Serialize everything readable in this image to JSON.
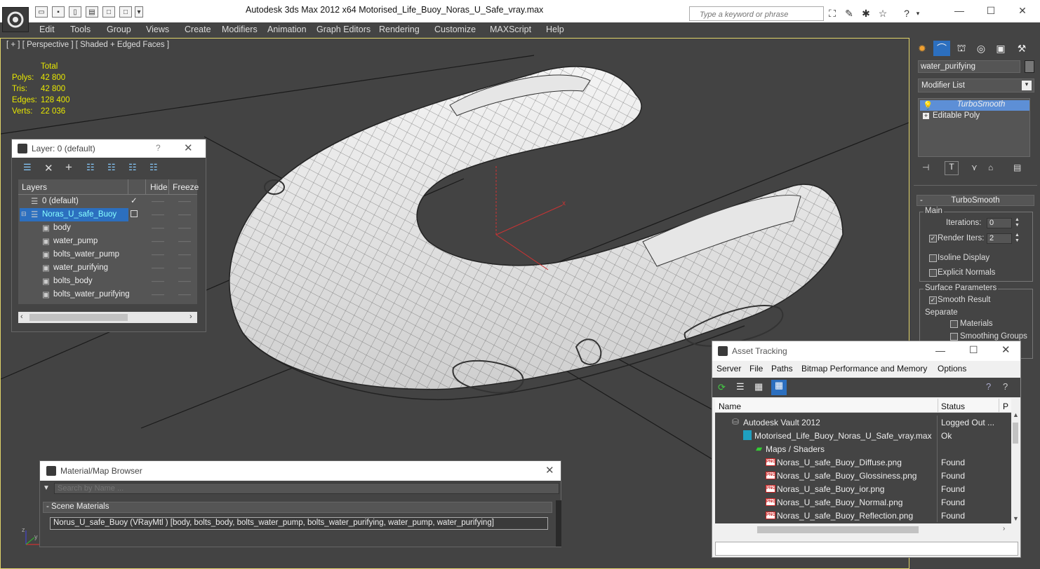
{
  "app": {
    "title": "Autodesk 3ds Max  2012 x64     Motorised_Life_Buoy_Noras_U_Safe_vray.max",
    "search_placeholder": "Type a keyword or phrase"
  },
  "menu": [
    "Edit",
    "Tools",
    "Group",
    "Views",
    "Create",
    "Modifiers",
    "Animation",
    "Graph Editors",
    "Rendering",
    "Customize",
    "MAXScript",
    "Help"
  ],
  "viewport": {
    "label": "[ + ] [ Perspective ] [ Shaded + Edged Faces ]",
    "stats": {
      "header": "Total",
      "rows": [
        {
          "label": "Polys:",
          "value": "42 800"
        },
        {
          "label": "Tris:",
          "value": "42 800"
        },
        {
          "label": "Edges:",
          "value": "128 400"
        },
        {
          "label": "Verts:",
          "value": "22 036"
        }
      ]
    },
    "axis_x": "x",
    "axis_y": "y",
    "axis_z": "z"
  },
  "command_panel": {
    "object_name": "water_purifying",
    "modifier_list": "Modifier List",
    "stack": [
      "TurboSmooth",
      "Editable Poly"
    ],
    "rollout_title": "TurboSmooth",
    "main_group": "Main",
    "iterations_label": "Iterations:",
    "iterations_value": "0",
    "render_iters_label": "Render Iters:",
    "render_iters_value": "2",
    "isoline_label": "Isoline Display",
    "explicit_normals_label": "Explicit Normals",
    "surface_group": "Surface Parameters",
    "smooth_result_label": "Smooth Result",
    "separate_label": "Separate",
    "materials_label": "Materials",
    "smoothing_groups_label": "Smoothing Groups"
  },
  "layer_window": {
    "title": "Layer: 0 (default)",
    "help": "?",
    "columns": [
      "Layers",
      "Hide",
      "Freeze"
    ],
    "rows": [
      {
        "name": "0 (default)",
        "indent": 1,
        "selected": false,
        "active": true
      },
      {
        "name": "Noras_U_safe_Buoy",
        "indent": 0,
        "selected": true,
        "active": false
      },
      {
        "name": "body",
        "indent": 2,
        "selected": false,
        "active": false
      },
      {
        "name": "water_pump",
        "indent": 2,
        "selected": false,
        "active": false
      },
      {
        "name": "bolts_water_pump",
        "indent": 2,
        "selected": false,
        "active": false
      },
      {
        "name": "water_purifying",
        "indent": 2,
        "selected": false,
        "active": false
      },
      {
        "name": "bolts_body",
        "indent": 2,
        "selected": false,
        "active": false
      },
      {
        "name": "bolts_water_purifying",
        "indent": 2,
        "selected": false,
        "active": false
      }
    ]
  },
  "material_browser": {
    "title": "Material/Map Browser",
    "search_placeholder": "Search by Name ...",
    "section": "- Scene Materials",
    "item": "Norus_U_safe_Buoy  (VRayMtl )  [body, bolts_body, bolts_water_pump, bolts_water_purifying, water_pump, water_purifying]"
  },
  "asset_tracking": {
    "title": "Asset Tracking",
    "menu": [
      "Server",
      "File",
      "Paths",
      "Bitmap Performance and Memory",
      "Options"
    ],
    "columns": [
      "Name",
      "Status",
      "P"
    ],
    "rows": [
      {
        "name": "Autodesk Vault 2012",
        "status": "Logged Out ...",
        "icon": "vault",
        "indent": 0
      },
      {
        "name": "Motorised_Life_Buoy_Noras_U_Safe_vray.max",
        "status": "Ok",
        "icon": "max",
        "indent": 1
      },
      {
        "name": "Maps / Shaders",
        "status": "",
        "icon": "maps",
        "indent": 2
      },
      {
        "name": "Noras_U_safe_Buoy_Diffuse.png",
        "status": "Found",
        "icon": "png",
        "indent": 3
      },
      {
        "name": "Noras_U_safe_Buoy_Glossiness.png",
        "status": "Found",
        "icon": "png",
        "indent": 3
      },
      {
        "name": "Noras_U_safe_Buoy_ior.png",
        "status": "Found",
        "icon": "png",
        "indent": 3
      },
      {
        "name": "Noras_U_safe_Buoy_Normal.png",
        "status": "Found",
        "icon": "png",
        "indent": 3
      },
      {
        "name": "Noras_U_safe_Buoy_Reflection.png",
        "status": "Found",
        "icon": "png",
        "indent": 3
      }
    ]
  },
  "colors": {
    "accent": "#1e78d0",
    "stats": "#e8e800",
    "viewport_border": "#e2d56a"
  }
}
